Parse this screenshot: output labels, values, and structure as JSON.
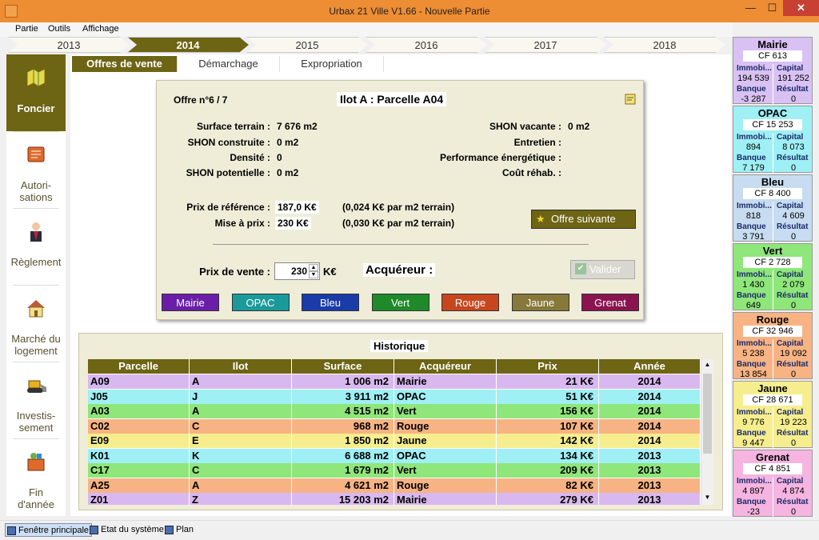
{
  "window": {
    "title": "Urbax 21 Ville V1.66 - Nouvelle Partie",
    "min": "—",
    "max": "☐",
    "close": "✕"
  },
  "menu": [
    "Partie",
    "Outils",
    "Affichage"
  ],
  "years": [
    {
      "label": "2013"
    },
    {
      "label": "2014",
      "active": true
    },
    {
      "label": "2015"
    },
    {
      "label": "2016"
    },
    {
      "label": "2017"
    },
    {
      "label": "2018"
    }
  ],
  "nav": [
    {
      "label1": "Foncier",
      "label2": "",
      "icon": "map-icon",
      "active": true
    },
    {
      "label1": "Autori-",
      "label2": "sations",
      "icon": "book-icon"
    },
    {
      "label1": "Règlement",
      "label2": "",
      "icon": "mayor-icon"
    },
    {
      "label1": "Marché du",
      "label2": "logement",
      "icon": "house-icon"
    },
    {
      "label1": "Investis-",
      "label2": "sement",
      "icon": "bulldozer-icon"
    },
    {
      "label1": "Fin",
      "label2": "d'année",
      "icon": "box-icon"
    }
  ],
  "tabs": [
    {
      "label": "Offres de vente",
      "active": true
    },
    {
      "label": "Démarchage"
    },
    {
      "label": "Expropriation"
    }
  ],
  "offer": {
    "number": "Offre n°6 / 7",
    "title": "Ilot A : Parcelle A04",
    "surface_label": "Surface terrain :",
    "surface": "7 676 m2",
    "shon_c_label": "SHON construite :",
    "shon_c": "0 m2",
    "densite_label": "Densité :",
    "densite": "0",
    "shon_p_label": "SHON potentielle :",
    "shon_p": "0 m2",
    "shon_v_label": "SHON vacante :",
    "shon_v": "0 m2",
    "entretien_label": "Entretien :",
    "perf_label": "Performance énergétique :",
    "cout_label": "Coût réhab. :",
    "prix_ref_label": "Prix de référence :",
    "prix_ref": "187,0 K€",
    "prix_ref_m2": "(0,024 K€ par m2 terrain)",
    "mise_label": "Mise à prix :",
    "mise": "230 K€",
    "mise_m2": "(0,030 K€ par m2 terrain)",
    "next_button": "Offre suivante",
    "prix_vente_label": "Prix de vente :",
    "prix_vente": "230",
    "unit": "K€",
    "acquereur_label": "Acquéreur :",
    "valider": "Valider",
    "players": [
      {
        "name": "Mairie",
        "color": "#6a1ea8"
      },
      {
        "name": "OPAC",
        "color": "#1a9a9a"
      },
      {
        "name": "Bleu",
        "color": "#1a3ca8"
      },
      {
        "name": "Vert",
        "color": "#1f8a2a"
      },
      {
        "name": "Rouge",
        "color": "#c8461e"
      },
      {
        "name": "Jaune",
        "color": "#86793a"
      },
      {
        "name": "Grenat",
        "color": "#8a1450"
      }
    ]
  },
  "historique": {
    "title": "Historique",
    "columns": [
      "Parcelle",
      "Ilot",
      "Surface",
      "Acquéreur",
      "Prix",
      "Année"
    ],
    "rows": [
      {
        "parcelle": "A09",
        "ilot": "A",
        "surface": "1 006 m2",
        "acq": "Mairie",
        "prix": "21 K€",
        "annee": "2014",
        "bg": "#d9b8f0"
      },
      {
        "parcelle": "J05",
        "ilot": "J",
        "surface": "3 911 m2",
        "acq": "OPAC",
        "prix": "51 K€",
        "annee": "2014",
        "bg": "#9ef0f5"
      },
      {
        "parcelle": "A03",
        "ilot": "A",
        "surface": "4 515 m2",
        "acq": "Vert",
        "prix": "156 K€",
        "annee": "2014",
        "bg": "#8fe67a"
      },
      {
        "parcelle": "C02",
        "ilot": "C",
        "surface": "968 m2",
        "acq": "Rouge",
        "prix": "107 K€",
        "annee": "2014",
        "bg": "#f7b383"
      },
      {
        "parcelle": "E09",
        "ilot": "E",
        "surface": "1 850 m2",
        "acq": "Jaune",
        "prix": "142 K€",
        "annee": "2014",
        "bg": "#f6ee8e"
      },
      {
        "parcelle": "K01",
        "ilot": "K",
        "surface": "6 688 m2",
        "acq": "OPAC",
        "prix": "134 K€",
        "annee": "2013",
        "bg": "#9ef0f5"
      },
      {
        "parcelle": "C17",
        "ilot": "C",
        "surface": "1 679 m2",
        "acq": "Vert",
        "prix": "209 K€",
        "annee": "2013",
        "bg": "#8fe67a"
      },
      {
        "parcelle": "A25",
        "ilot": "A",
        "surface": "4 621 m2",
        "acq": "Rouge",
        "prix": "82 K€",
        "annee": "2013",
        "bg": "#f7b383"
      },
      {
        "parcelle": "Z01",
        "ilot": "Z",
        "surface": "15 203 m2",
        "acq": "Mairie",
        "prix": "279 K€",
        "annee": "2013",
        "bg": "#d9b8f0"
      }
    ]
  },
  "cards": [
    {
      "name": "Mairie",
      "cf": "CF 613",
      "immo": "194 539",
      "capital": "191 252",
      "banque": "-3 287",
      "resultat": "0",
      "bg": "#d9c2f3"
    },
    {
      "name": "OPAC",
      "cf": "CF 15 253",
      "immo": "894",
      "capital": "8 073",
      "banque": "7 179",
      "resultat": "0",
      "bg": "#9ff0f5"
    },
    {
      "name": "Bleu",
      "cf": "CF 8 400",
      "immo": "818",
      "capital": "4 609",
      "banque": "3 791",
      "resultat": "0",
      "bg": "#c7dcf0"
    },
    {
      "name": "Vert",
      "cf": "CF 2 728",
      "immo": "1 430",
      "capital": "2 079",
      "banque": "649",
      "resultat": "0",
      "bg": "#8fe67a"
    },
    {
      "name": "Rouge",
      "cf": "CF 32 946",
      "immo": "5 238",
      "capital": "19 092",
      "banque": "13 854",
      "resultat": "0",
      "bg": "#f7b383"
    },
    {
      "name": "Jaune",
      "cf": "CF 28 671",
      "immo": "9 776",
      "capital": "19 223",
      "banque": "9 447",
      "resultat": "0",
      "bg": "#f6ee8e"
    },
    {
      "name": "Grenat",
      "cf": "CF 4 851",
      "immo": "4 897",
      "capital": "4 874",
      "banque": "-23",
      "resultat": "0",
      "bg": "#f5b5e0"
    }
  ],
  "card_labels": {
    "immo": "Immobi...",
    "capital": "Capital",
    "banque": "Banque",
    "resultat": "Résultat"
  },
  "statusbar": [
    "Fenêtre principale",
    "Etat du système",
    "Plan"
  ]
}
